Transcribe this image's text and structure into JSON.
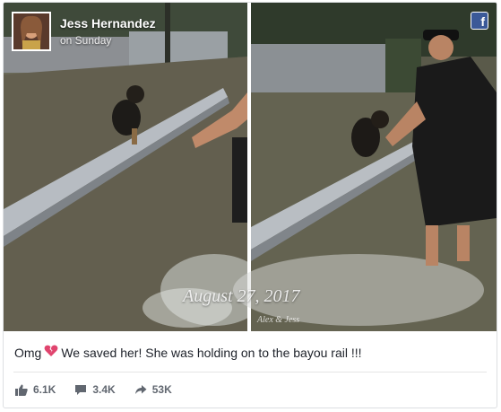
{
  "post": {
    "author": "Jess Hernandez",
    "time": "on Sunday",
    "watermark": "August 27, 2017",
    "watermark_sig": "Alex & Jess",
    "caption_before": "Omg",
    "caption_after": "We saved her! She was holding on to the bayou rail !!!",
    "badge_letter": "f"
  },
  "stats": {
    "likes": "6.1K",
    "comments": "3.4K",
    "shares": "53K"
  },
  "icons": {
    "badge": "facebook-icon",
    "heart": "broken-heart-icon",
    "like": "thumbs-up-icon",
    "comment": "comment-icon",
    "share": "share-arrow-icon"
  },
  "colors": {
    "facebook": "#3b5998",
    "stat_text": "#616770",
    "caption_text": "#1d2129",
    "heart": "#e0446e"
  }
}
